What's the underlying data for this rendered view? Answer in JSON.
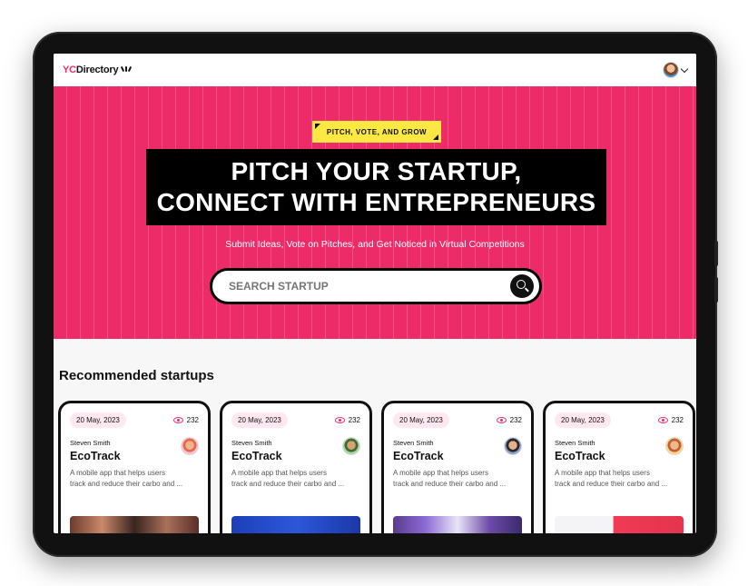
{
  "navbar": {
    "logo_prefix": "YC",
    "logo_suffix": "Directory"
  },
  "hero": {
    "tag": "PITCH, VOTE, AND GROW",
    "heading_line1": "PITCH YOUR STARTUP,",
    "heading_line2": "CONNECT WITH ENTREPRENEURS",
    "subheading": "Submit Ideas, Vote on Pitches, and Get Noticed in Virtual Competitions",
    "search_placeholder": "SEARCH STARTUP"
  },
  "section": {
    "title": "Recommended startups"
  },
  "cards": [
    {
      "date": "20 May, 2023",
      "views": "232",
      "author": "Steven Smith",
      "title": "EcoTrack",
      "description_line1": "A mobile app that helps users",
      "description_line2": "track and reduce their carbo and ..."
    },
    {
      "date": "20 May, 2023",
      "views": "232",
      "author": "Steven Smith",
      "title": "EcoTrack",
      "description_line1": "A mobile app that helps users",
      "description_line2": "track and reduce their carbo and ..."
    },
    {
      "date": "20 May, 2023",
      "views": "232",
      "author": "Steven Smith",
      "title": "EcoTrack",
      "description_line1": "A mobile app that helps users",
      "description_line2": "track and reduce their carbo and ..."
    },
    {
      "date": "20 May, 2023",
      "views": "232",
      "author": "Steven Smith",
      "title": "EcoTrack",
      "description_line1": "A mobile app that helps users",
      "description_line2": "track and reduce their carbo and ..."
    }
  ],
  "colors": {
    "brand": "#ee2b69",
    "accent": "#fbe843",
    "dark": "#111111"
  },
  "icons": {
    "search": "search-icon",
    "views": "eye-icon",
    "menu": "chevron-down-icon"
  }
}
